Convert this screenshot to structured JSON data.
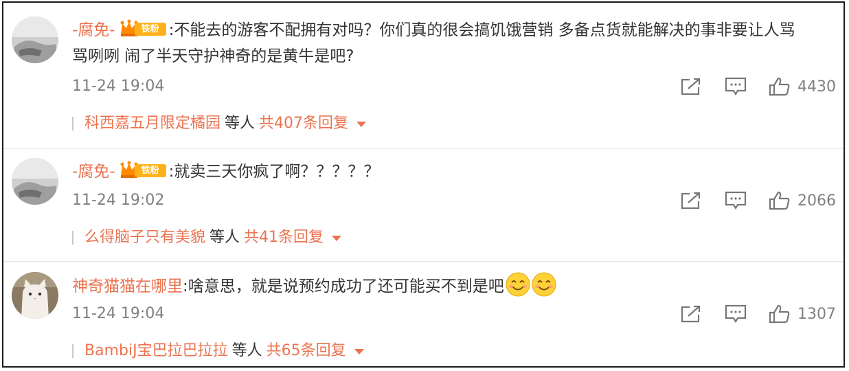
{
  "colors": {
    "accent": "#eb7350",
    "badge": "#ffb11b",
    "meta": "#808080"
  },
  "comments": [
    {
      "username": "-腐免-",
      "badge": "铁粉",
      "text": ":不能去的游客不配拥有对吗？你们真的很会搞饥饿营销 多备点货就能解决的事非要让人骂",
      "text2": "骂咧咧 闹了半天守护神奇的是黄牛是吧?",
      "time": "11-24 19:04",
      "likes": "4430",
      "reply_user": "科西嘉五月限定橘园",
      "reply_mid": "等人",
      "reply_total": "共407条回复"
    },
    {
      "username": "-腐免-",
      "badge": "铁粉",
      "text": ":就卖三天你疯了啊？？？？？",
      "time": "11-24 19:02",
      "likes": "2066",
      "reply_user": "么得脑子只有美貌",
      "reply_mid": "等人",
      "reply_total": "共41条回复"
    },
    {
      "username": "神奇猫猫在哪里",
      "text": ":啥意思，就是说预约成功了还可能买不到是吧",
      "time": "11-24 19:04",
      "likes": "1307",
      "reply_user": "BambiJ宝巴拉巴拉拉",
      "reply_mid": "等人",
      "reply_total": "共65条回复"
    }
  ],
  "icons": [
    "share-icon",
    "comment-icon",
    "like-icon",
    "crown-icon",
    "smile-emoji-icon"
  ]
}
